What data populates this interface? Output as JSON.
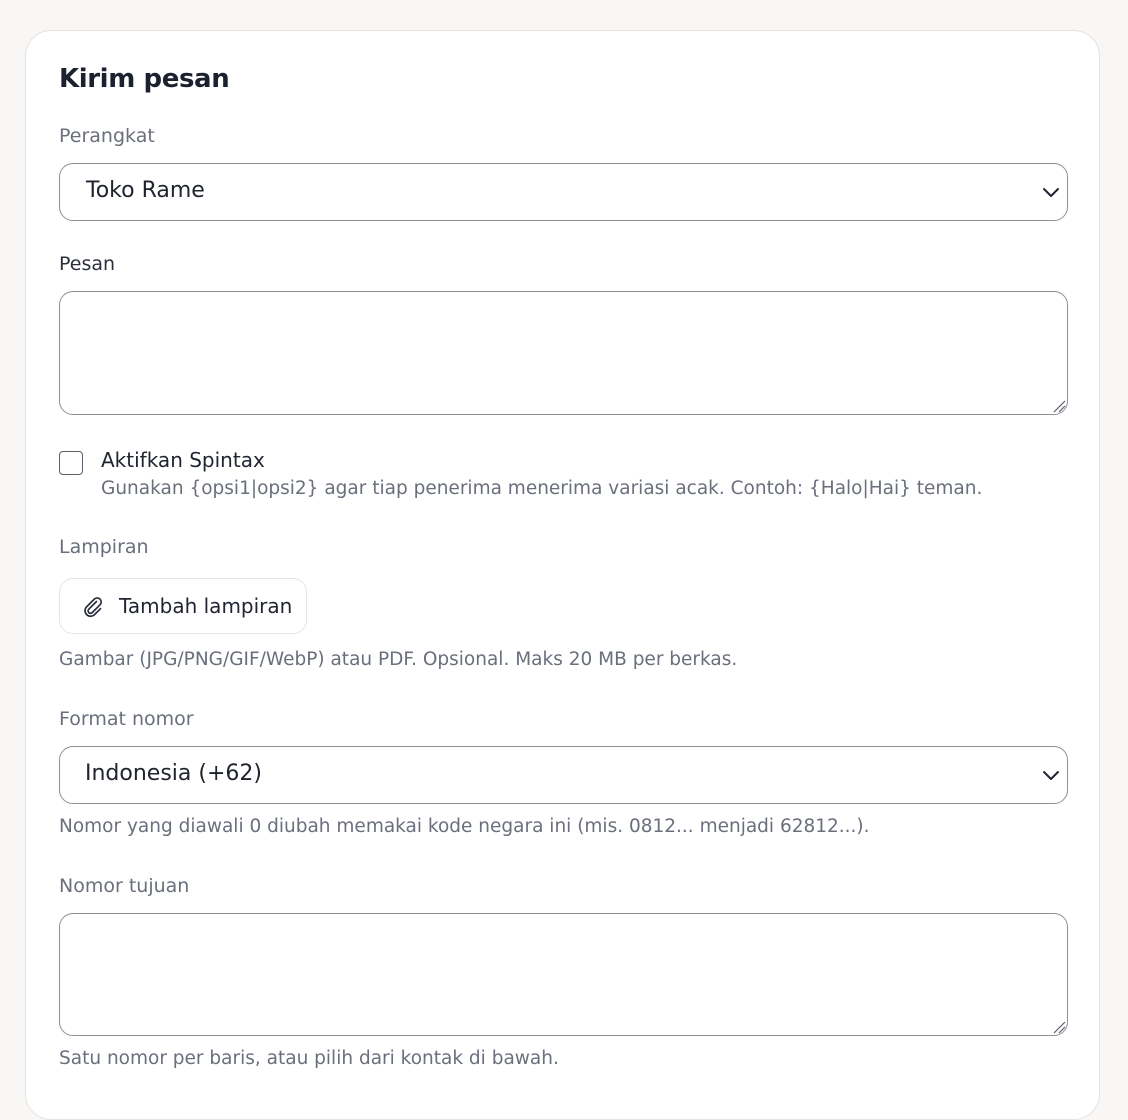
{
  "form": {
    "title": "Kirim pesan",
    "device": {
      "label": "Perangkat",
      "selected": "Toko Rame"
    },
    "message": {
      "label": "Pesan",
      "value": ""
    },
    "spintax": {
      "label": "Aktifkan Spintax",
      "checked": false,
      "help": "Gunakan {opsi1|opsi2} agar tiap penerima menerima variasi acak. Contoh: {Halo|Hai} teman."
    },
    "attachments": {
      "label": "Lampiran",
      "button_label": "Tambah lampiran",
      "button_icon": "paperclip-icon",
      "help": "Gambar (JPG/PNG/GIF/WebP) atau PDF. Opsional. Maks 20 MB per berkas."
    },
    "number_format": {
      "label": "Format nomor",
      "selected": "Indonesia (+62)",
      "help": "Nomor yang diawali 0 diubah memakai kode negara ini (mis. 0812... menjadi 62812...)."
    },
    "recipients": {
      "label": "Nomor tujuan",
      "value": "",
      "help": "Satu nomor per baris, atau pilih dari kontak di bawah."
    }
  },
  "colors": {
    "page_background": "#f8f7f5",
    "card_background": "#ffffff",
    "input_border": "#8d9099",
    "muted_text": "#6a6f7c",
    "heading_text": "#1c2130"
  }
}
